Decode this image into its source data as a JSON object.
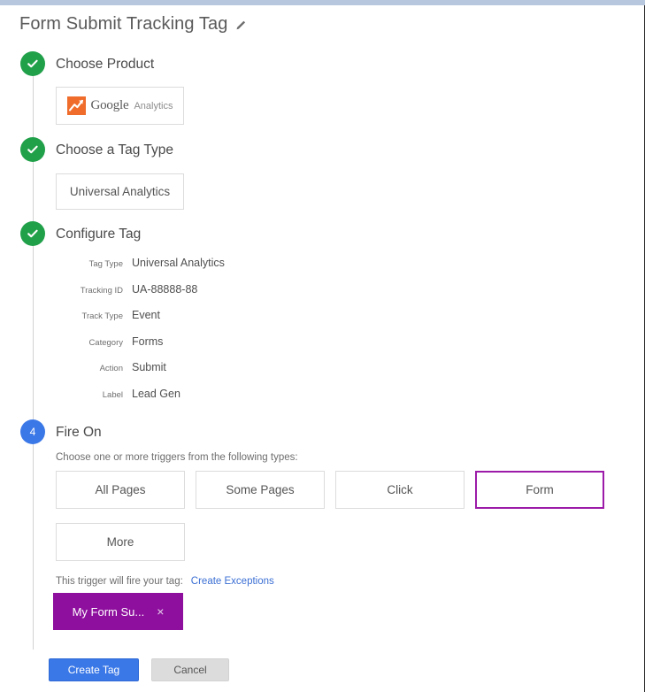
{
  "page": {
    "title": "Form Submit Tracking Tag",
    "edit_icon": "pencil-icon"
  },
  "colors": {
    "step_done": "#21a04a",
    "step_active": "#3b78e7",
    "selected_trigger_border": "#9c1ba8",
    "chip_background": "#8e0f9e",
    "primary_button": "#3b78e7",
    "link": "#3b6fd4",
    "ga_orange": "#ef6c2b",
    "topbar": "#b7c8de"
  },
  "steps": [
    {
      "number": "1",
      "state": "done",
      "title": "Choose Product",
      "check_icon": "check-icon"
    },
    {
      "number": "2",
      "state": "done",
      "title": "Choose a Tag Type",
      "check_icon": "check-icon"
    },
    {
      "number": "3",
      "state": "done",
      "title": "Configure Tag",
      "check_icon": "check-icon"
    },
    {
      "number": "4",
      "state": "active",
      "title": "Fire On",
      "check_icon": ""
    }
  ],
  "product": {
    "logo_icon": "google-analytics-icon",
    "brand": "Google",
    "product_name": "Analytics"
  },
  "tag_type": {
    "value": "Universal Analytics"
  },
  "configure_tag": {
    "rows": [
      {
        "key": "Tag Type",
        "value": "Universal Analytics"
      },
      {
        "key": "Tracking ID",
        "value": "UA-88888-88"
      },
      {
        "key": "Track Type",
        "value": "Event"
      },
      {
        "key": "Category",
        "value": "Forms"
      },
      {
        "key": "Action",
        "value": "Submit"
      },
      {
        "key": "Label",
        "value": "Lead Gen"
      }
    ]
  },
  "fire_on": {
    "help_text": "Choose one or more triggers from the following types:",
    "triggers": [
      {
        "label": "All Pages",
        "selected": false
      },
      {
        "label": "Some Pages",
        "selected": false
      },
      {
        "label": "Click",
        "selected": false
      },
      {
        "label": "Form",
        "selected": true
      }
    ],
    "more_label": "More",
    "note_text": "This trigger will fire your tag:",
    "exceptions_link": "Create Exceptions",
    "chip": {
      "label": "My Form Su...",
      "close_icon": "×"
    }
  },
  "footer": {
    "create_label": "Create Tag",
    "cancel_label": "Cancel"
  }
}
